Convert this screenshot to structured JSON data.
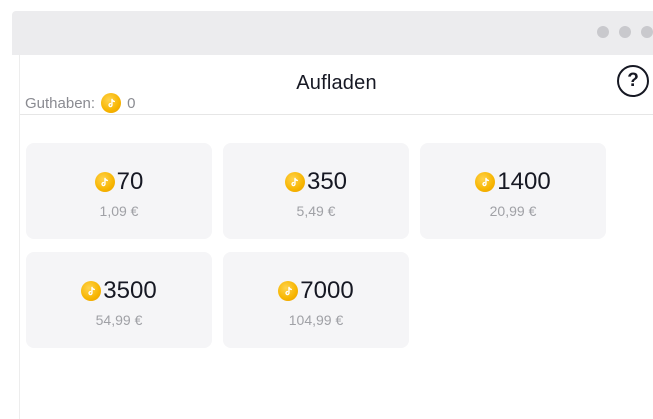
{
  "header": {
    "title": "Aufladen",
    "help_icon": "question-circle-icon"
  },
  "balance": {
    "label": "Guthaben:",
    "value": "0"
  },
  "packages": [
    {
      "amount": "70",
      "price": "1,09 €"
    },
    {
      "amount": "350",
      "price": "5,49 €"
    },
    {
      "amount": "1400",
      "price": "20,99 €"
    },
    {
      "amount": "3500",
      "price": "54,99 €"
    },
    {
      "amount": "7000",
      "price": "104,99 €"
    }
  ],
  "colors": {
    "coin": "#f7b500",
    "card_bg": "#f5f5f7",
    "text": "#161823",
    "muted": "#a0a1a6"
  }
}
